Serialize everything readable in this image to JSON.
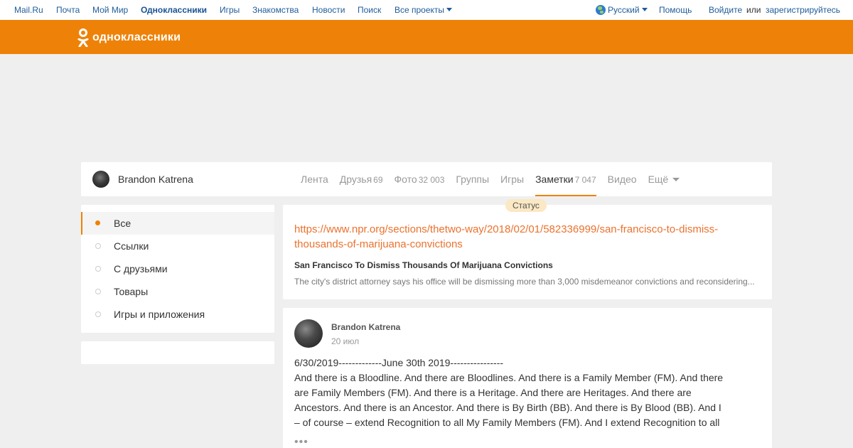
{
  "portal": {
    "left_links": [
      "Mail.Ru",
      "Почта",
      "Мой Мир",
      "Одноклассники",
      "Игры",
      "Знакомства",
      "Новости",
      "Поиск",
      "Все проекты"
    ],
    "language": "Русский",
    "help": "Помощь",
    "login": "Войдите",
    "or": "или",
    "register": "зарегистрируйтесь"
  },
  "header": {
    "logo_text": "одноклассники",
    "accent_color": "#ee8208"
  },
  "profile": {
    "name": "Brandon Katrena",
    "tabs": [
      {
        "label": "Лента",
        "count": ""
      },
      {
        "label": "Друзья",
        "count": "69"
      },
      {
        "label": "Фото",
        "count": "32 003"
      },
      {
        "label": "Группы",
        "count": ""
      },
      {
        "label": "Игры",
        "count": ""
      },
      {
        "label": "Заметки",
        "count": "7 047"
      },
      {
        "label": "Видео",
        "count": ""
      },
      {
        "label": "Ещё",
        "count": ""
      }
    ],
    "active_tab": "Заметки"
  },
  "left_menu": {
    "items": [
      "Все",
      "Ссылки",
      "С друзьями",
      "Товары",
      "Игры и приложения"
    ],
    "active": "Все"
  },
  "status_card": {
    "badge": "Статус",
    "link": "https://www.npr.org/sections/thetwo-way/2018/02/01/582336999/san-francisco-to-dismiss-thousands-of-marijuana-convictions",
    "title": "San Francisco To Dismiss Thousands Of Marijuana Convictions",
    "description": "The city's district attorney says his office will be dismissing more than 3,000 misdemeanor convictions and reconsidering..."
  },
  "post": {
    "author": "Brandon Katrena",
    "date": "20 июл",
    "line1": "6/30/2019-------------June 30th 2019----------------",
    "body": "And there is a Bloodline. And there are Bloodlines. And there is a Family Member (FM). And there are Family Members (FM). And there is a Heritage. And there are Heritages. And there are Ancestors. And there is an Ancestor. And there is By Birth (BB). And there is By Blood (BB). And I – of course – extend Recognition to all My Family Members (FM). And I extend Recognition to all",
    "more": "•••"
  }
}
